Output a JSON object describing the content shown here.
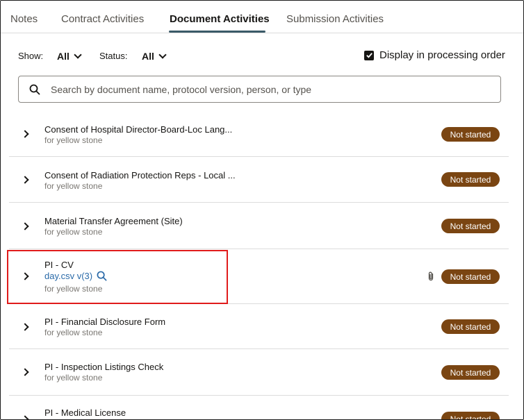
{
  "tabs": [
    {
      "label": "Notes",
      "active": false
    },
    {
      "label": "Contract Activities",
      "active": false
    },
    {
      "label": "Document Activities",
      "active": true
    },
    {
      "label": "Submission Activities",
      "active": false
    }
  ],
  "filters": {
    "show_label": "Show:",
    "show_value": "All",
    "status_label": "Status:",
    "status_value": "All",
    "processing_order_label": "Display in processing order",
    "processing_order_checked": true
  },
  "search": {
    "placeholder": "Search by document name, protocol version, person, or type",
    "value": ""
  },
  "rows": [
    {
      "title": "Consent of Hospital Director-Board-Loc Lang...",
      "subtitle": "for yellow stone",
      "status": "Not started"
    },
    {
      "title": "Consent of Radiation Protection Reps - Local ...",
      "subtitle": "for yellow stone",
      "status": "Not started"
    },
    {
      "title": "Material Transfer Agreement (Site)",
      "subtitle": "for yellow stone",
      "status": "Not started"
    },
    {
      "title": "PI - CV",
      "file_link": "day.csv v(3)",
      "subtitle": "for yellow stone",
      "status": "Not started",
      "has_attachment": true
    },
    {
      "title": "PI - Financial Disclosure Form",
      "subtitle": "for yellow stone",
      "status": "Not started"
    },
    {
      "title": "PI - Inspection Listings Check",
      "subtitle": "for yellow stone",
      "status": "Not started"
    },
    {
      "title": "PI - Medical License",
      "subtitle": "",
      "status": "Not started"
    }
  ],
  "colors": {
    "badge_bg": "#7a4512",
    "link": "#2a6aa8",
    "highlight": "#e01b1b"
  },
  "icons": {
    "search": "magnifier",
    "expand": "chevron-right",
    "dropdown": "chevron-down",
    "attachment": "paperclip",
    "checkbox": "check"
  }
}
